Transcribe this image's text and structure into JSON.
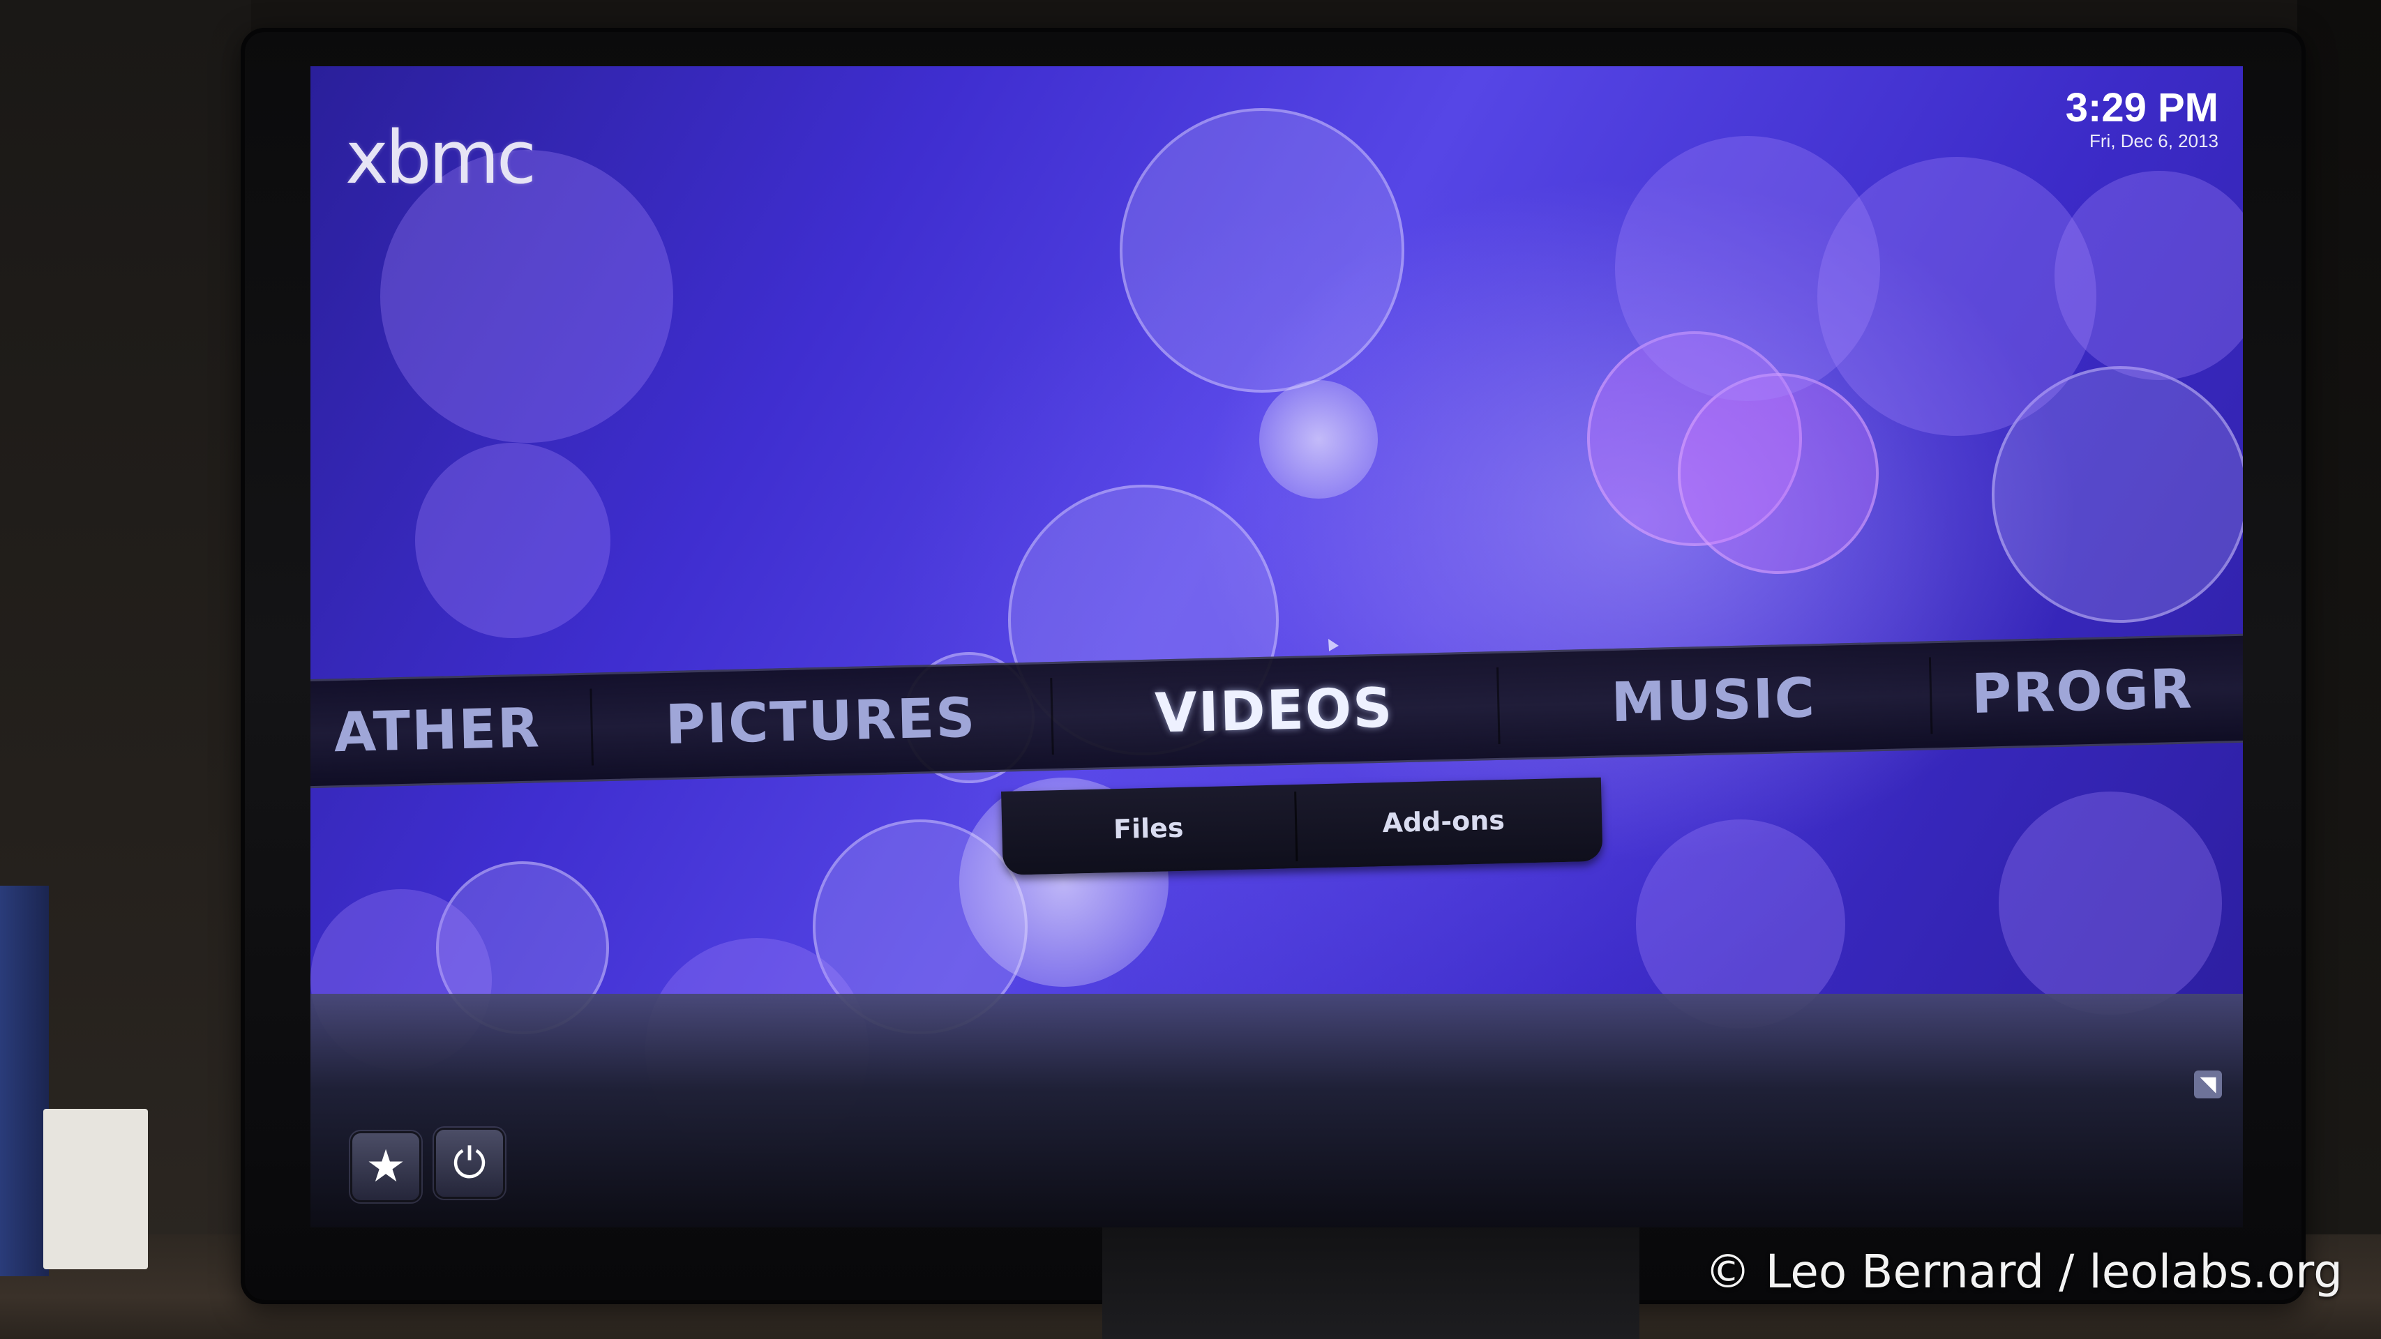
{
  "app": {
    "logo_text": "xbmc"
  },
  "clock": {
    "time": "3:29 PM",
    "date": "Fri, Dec 6, 2013"
  },
  "home_menu": {
    "items": [
      {
        "label": "ATHER"
      },
      {
        "label": "PICTURES"
      },
      {
        "label": "VIDEOS",
        "selected": true
      },
      {
        "label": "MUSIC"
      },
      {
        "label": "PROGR"
      }
    ],
    "submenu": [
      {
        "label": "Files"
      },
      {
        "label": "Add-ons"
      }
    ]
  },
  "bottom_bar": {
    "buttons": [
      {
        "icon": "star-icon",
        "glyph": "★"
      },
      {
        "icon": "power-icon",
        "glyph": "⏻"
      }
    ],
    "rss_icon": "rss-icon"
  },
  "watermark": "© Leo Bernard / leolabs.org",
  "colors": {
    "background_primary": "#3f2ed0",
    "menu_text": "#9fa6d8",
    "menu_text_active": "#eef1ff"
  }
}
